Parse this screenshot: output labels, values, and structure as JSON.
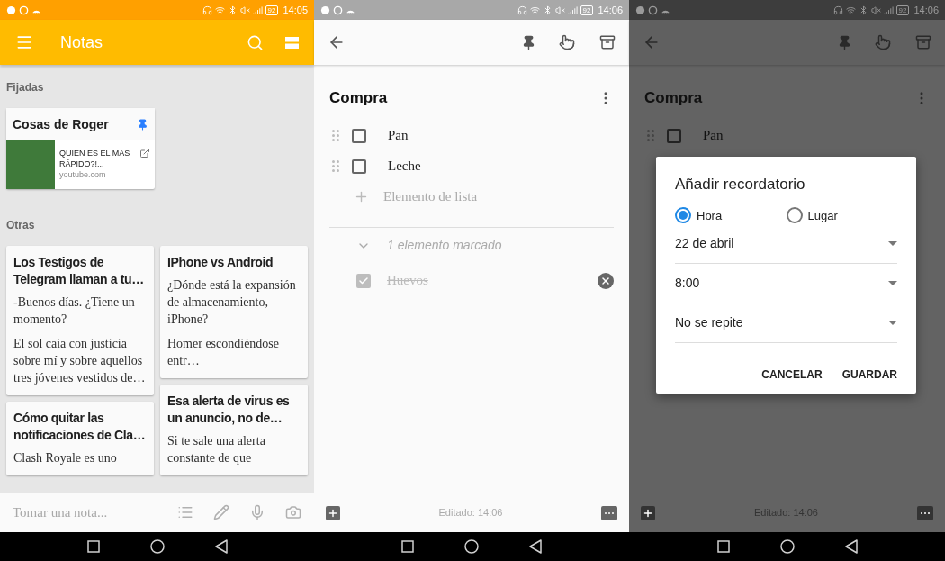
{
  "screens": [
    {
      "kind": "notes",
      "status": {
        "time": "14:05",
        "battery": "92"
      },
      "app_bar": {
        "title": "Notas"
      },
      "pinned_section": {
        "heading": "Fijadas",
        "notes": [
          {
            "title": "Cosas de Roger",
            "pinned": true,
            "link": {
              "title": "QUIÉN ES EL MÁS RÁPIDO?!...",
              "domain": "youtube.com"
            }
          }
        ]
      },
      "other_section": {
        "heading": "Otras",
        "columns": [
          [
            {
              "title": "Los Testigos de Telegram llaman a tu…",
              "paragraphs": [
                "-Buenos días. ¿Tiene un momento?",
                "El sol caía con justicia sobre mí y sobre aquellos tres jóvenes vestidos de…"
              ]
            },
            {
              "title": "Cómo quitar las notificaciones de Cla…",
              "paragraphs": [
                "Clash Royale es uno"
              ]
            }
          ],
          [
            {
              "title": "IPhone vs Android",
              "paragraphs": [
                "¿Dónde está la expansión de almacenamiento, iPhone?",
                "Homer escondiéndose entr…"
              ]
            },
            {
              "title": "Esa alerta de virus es un anuncio, no de…",
              "paragraphs": [
                "Si te sale una alerta constante de que"
              ]
            }
          ]
        ]
      },
      "compose": {
        "placeholder": "Tomar una nota..."
      }
    },
    {
      "kind": "editor",
      "status": {
        "time": "14:06",
        "battery": "92"
      },
      "title": "Compra",
      "items": [
        {
          "text": "Pan",
          "checked": false
        },
        {
          "text": "Leche",
          "checked": false
        }
      ],
      "add_item": {
        "placeholder": "Elemento de lista"
      },
      "checked_section": {
        "label": "1 elemento marcado",
        "expanded": true,
        "items": [
          {
            "text": "Huevos",
            "checked": true
          }
        ]
      },
      "footer": "Editado: 14:06"
    },
    {
      "kind": "reminder",
      "status": {
        "time": "14:06",
        "battery": "92"
      },
      "title": "Compra",
      "items": [
        {
          "text": "Pan",
          "checked": false
        }
      ],
      "dialog": {
        "title": "Añadir recordatorio",
        "options": [
          {
            "label": "Hora",
            "selected": true
          },
          {
            "label": "Lugar",
            "selected": false
          }
        ],
        "fields": [
          "22 de abril",
          "8:00",
          "No se repite"
        ],
        "buttons": [
          "CANCELAR",
          "GUARDAR"
        ]
      },
      "footer": "Editado: 14:06"
    }
  ]
}
